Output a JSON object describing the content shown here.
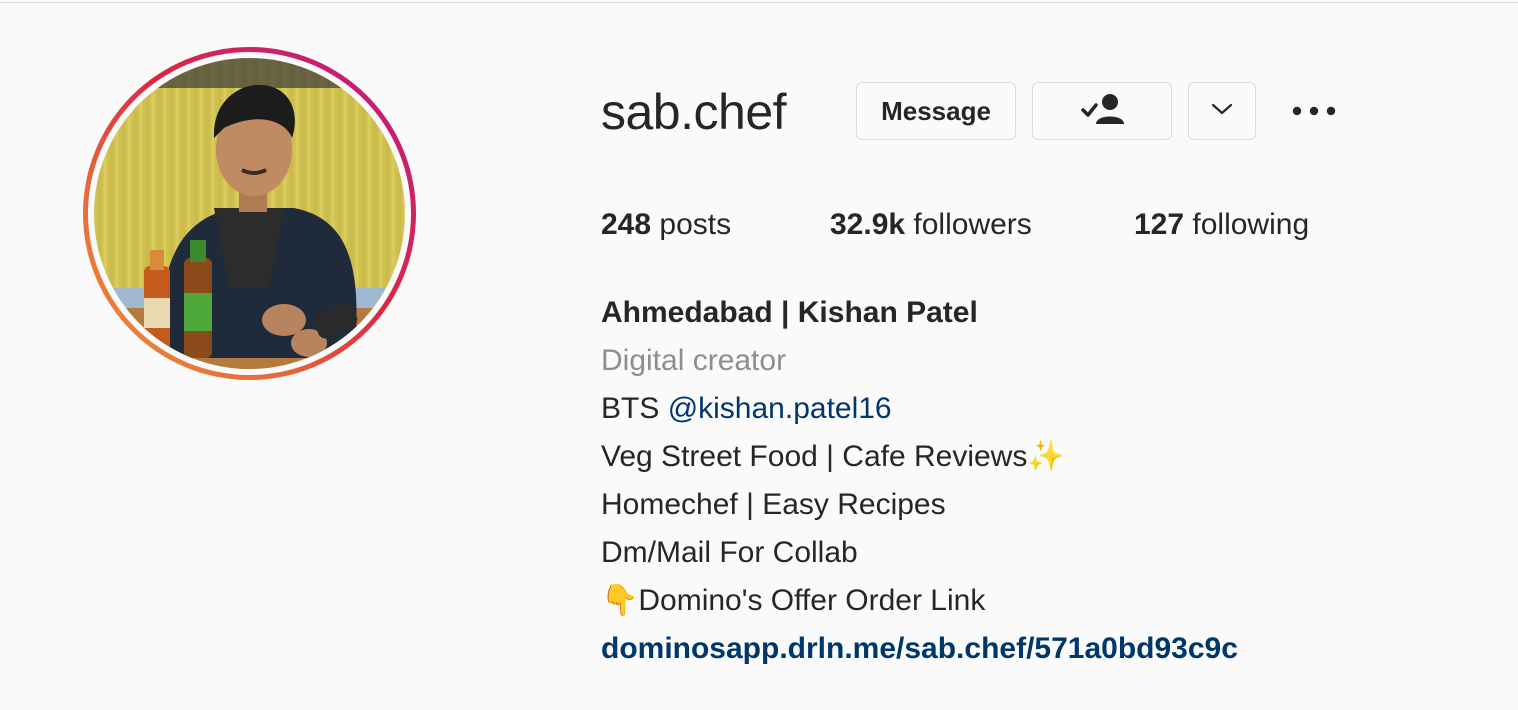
{
  "profile": {
    "username": "sab.chef",
    "message_label": "Message",
    "following_icon": "person-check-icon",
    "dropdown_icon": "chevron-down-icon",
    "more_icon": "more-options-icon"
  },
  "stats": {
    "posts_count": "248",
    "posts_label": " posts",
    "followers_count": "32.9k",
    "followers_label": " followers",
    "following_count": "127",
    "following_label": " following"
  },
  "bio": {
    "name": "Ahmedabad | Kishan Patel",
    "category": "Digital creator",
    "line3_prefix": "BTS ",
    "line3_mention": "@kishan.patel16",
    "line4": "Veg Street Food | Cafe Reviews✨",
    "line5": "Homechef | Easy Recipes",
    "line6": "Dm/Mail For Collab",
    "line7": "👇Domino's Offer Order Link",
    "link": "dominosapp.drln.me/sab.chef/571a0bd93c9c"
  },
  "colors": {
    "link": "#00376b",
    "text": "#262626",
    "muted": "#8e8e8e",
    "border": "#dbdbdb"
  }
}
